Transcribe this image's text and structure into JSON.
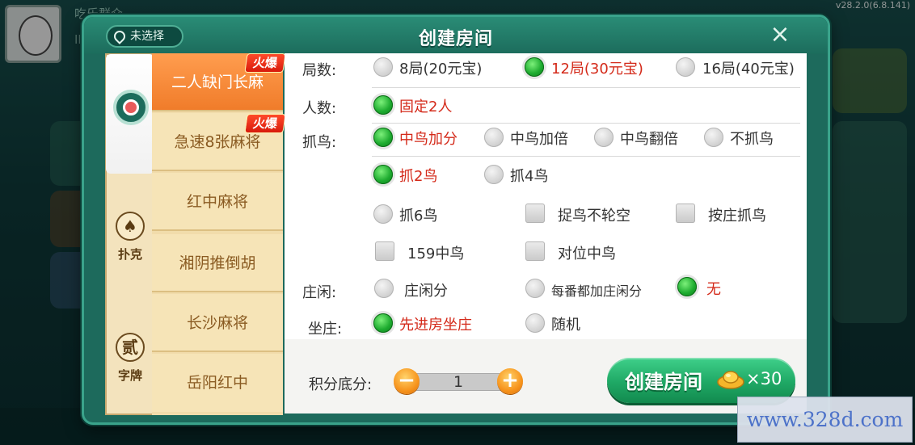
{
  "background": {
    "user_name": "吃乐群众",
    "user_id": "ID:5",
    "version": "v28.2.0(6.8.141)"
  },
  "header": {
    "title": "创建房间",
    "location": "未选择",
    "close": "×"
  },
  "categories": [
    {
      "label": "",
      "icon": "mahjong-icon"
    },
    {
      "label": "扑克",
      "icon": "♠"
    },
    {
      "label": "字牌",
      "icon": "贰"
    }
  ],
  "games": [
    {
      "label": "二人缺门长麻",
      "hot": "火爆"
    },
    {
      "label": "急速8张麻将",
      "hot": "火爆"
    },
    {
      "label": "红中麻将"
    },
    {
      "label": "湘阴推倒胡"
    },
    {
      "label": "长沙麻将"
    },
    {
      "label": "岳阳红中"
    }
  ],
  "options": {
    "rounds": {
      "label": "局数:",
      "items": [
        "8局(20元宝)",
        "12局(30元宝)",
        "16局(40元宝)"
      ],
      "selected": 1
    },
    "players": {
      "label": "人数:",
      "items": [
        "固定2人"
      ],
      "selected": 0
    },
    "bird": {
      "label": "抓鸟:",
      "items": [
        "中鸟加分",
        "中鸟加倍",
        "中鸟翻倍",
        "不抓鸟"
      ],
      "selected": 0
    },
    "bird_count": {
      "items": [
        "抓2鸟",
        "抓4鸟",
        "抓6鸟"
      ],
      "selected": 0
    },
    "bird_checks": [
      "捉鸟不轮空",
      "按庄抓鸟",
      "159中鸟",
      "对位中鸟"
    ],
    "banker": {
      "label": "庄闲:",
      "items": [
        "庄闲分",
        "每番都加庄闲分",
        "无"
      ],
      "selected": 2
    },
    "seat": {
      "label": "坐庄:",
      "items": [
        "先进房坐庄",
        "随机"
      ],
      "selected": 0
    }
  },
  "footer": {
    "score_label": "积分底分:",
    "score_value": "1",
    "minus": "−",
    "plus": "+",
    "create_label": "创建房间",
    "cost": "×30"
  },
  "watermark": "www.328d.com"
}
